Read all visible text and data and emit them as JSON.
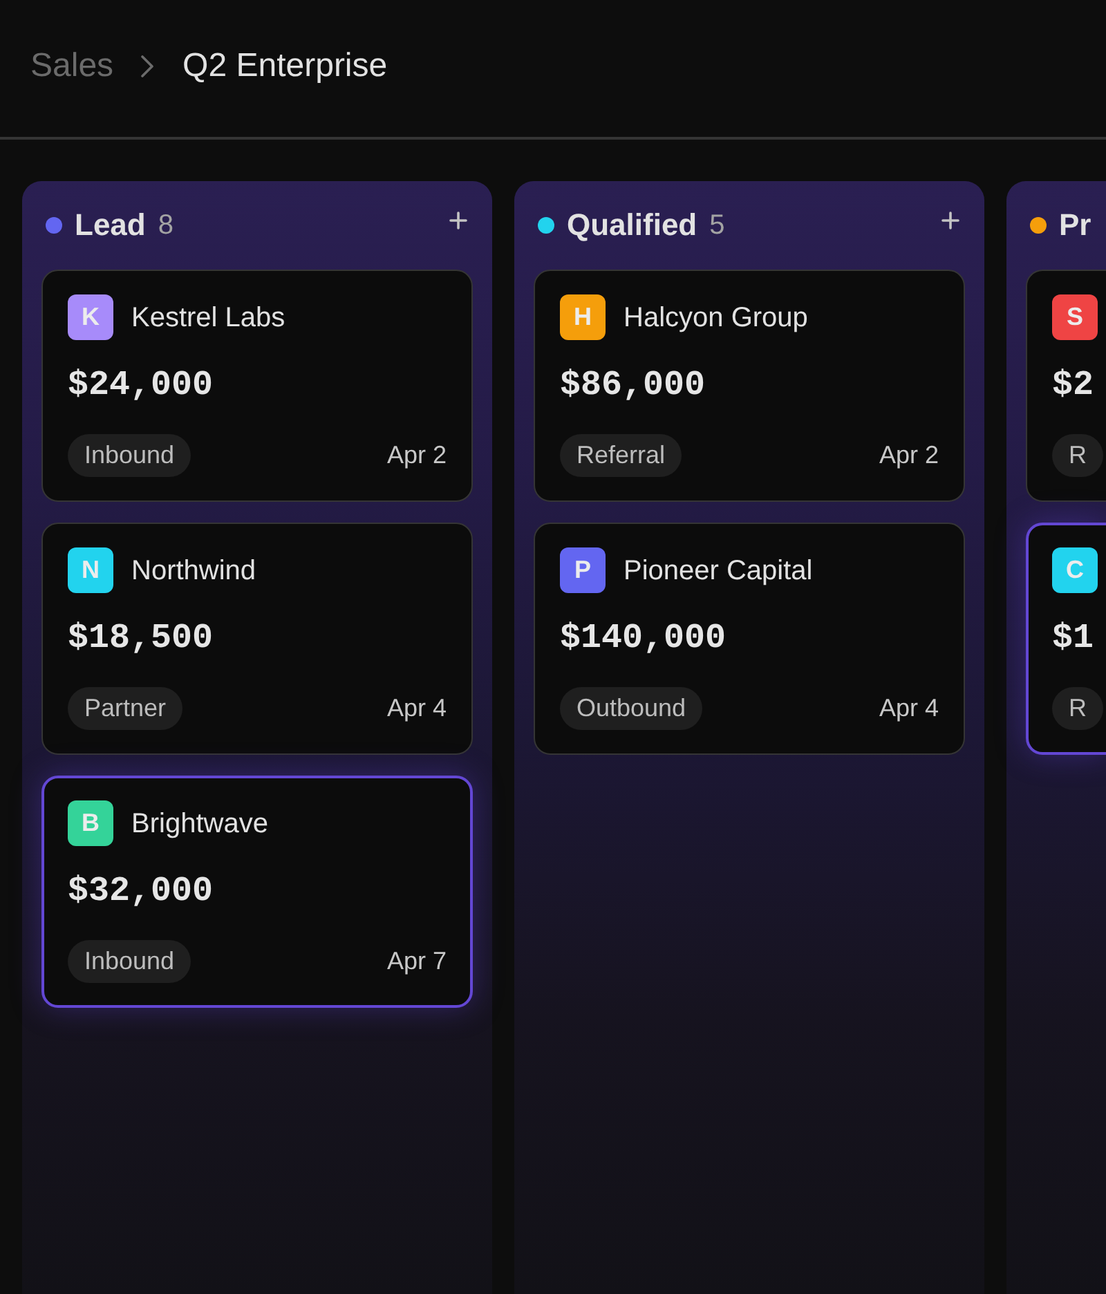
{
  "breadcrumb": [
    {
      "label": "Sales",
      "current": false
    },
    {
      "label": "Q2 Enterprise",
      "current": true
    }
  ],
  "columns": [
    {
      "title": "Lead",
      "count": "8",
      "color": "#6366f1",
      "add_button": true,
      "cards": [
        {
          "initial": "K",
          "color": "#a78bfa",
          "name": "Kestrel Labs",
          "amount": "$24,000",
          "tag": "Inbound",
          "date": "Apr 2",
          "selected": false
        },
        {
          "initial": "N",
          "color": "#22d3ee",
          "name": "Northwind",
          "amount": "$18,500",
          "tag": "Partner",
          "date": "Apr 4",
          "selected": false
        },
        {
          "initial": "B",
          "color": "#34d399",
          "name": "Brightwave",
          "amount": "$32,000",
          "tag": "Inbound",
          "date": "Apr 7",
          "selected": true
        }
      ]
    },
    {
      "title": "Qualified",
      "count": "5",
      "color": "#22d3ee",
      "add_button": true,
      "cards": [
        {
          "initial": "H",
          "color": "#f59e0b",
          "name": "Halcyon Group",
          "amount": "$86,000",
          "tag": "Referral",
          "date": "Apr 2",
          "selected": false
        },
        {
          "initial": "P",
          "color": "#6366f1",
          "name": "Pioneer Capital",
          "amount": "$140,000",
          "tag": "Outbound",
          "date": "Apr 4",
          "selected": false
        }
      ]
    },
    {
      "title": "Pr",
      "color": "#f59e0b",
      "cards": [
        {
          "initial": "S",
          "color": "#ef4444",
          "amount": "$2",
          "tag": "R",
          "selected": false
        },
        {
          "initial": "C",
          "color": "#22d3ee",
          "amount": "$1",
          "tag": "R",
          "selected": true
        }
      ]
    }
  ]
}
